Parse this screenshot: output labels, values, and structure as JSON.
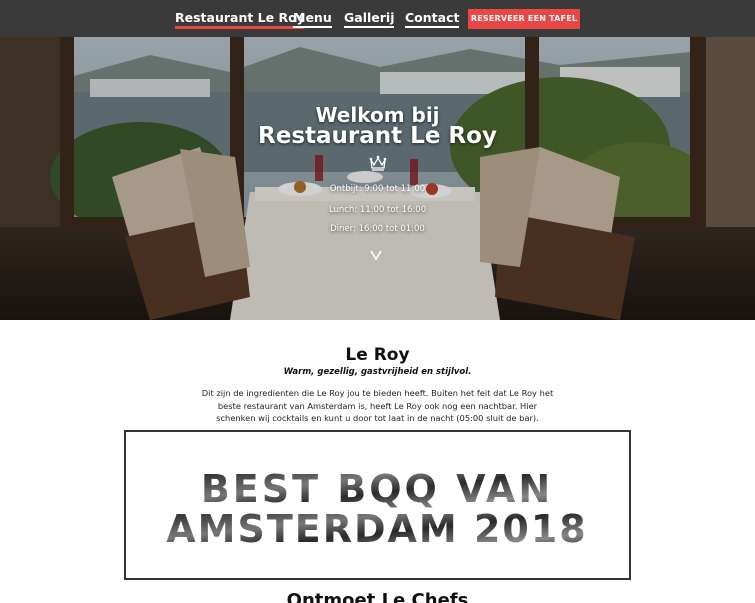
{
  "nav": {
    "brand": "Restaurant Le Roy",
    "menu": "Menu",
    "gallery": "Gallerij",
    "contact": "Contact",
    "reserve_button": "RESERVEER EEN TAFEL"
  },
  "hero": {
    "welcome_line1": "Welkom bij",
    "welcome_line2": "Restaurant Le Roy",
    "hours": [
      "Ontbijt: 9:00 tot 11:00",
      "Lunch: 11:00 tot 16:00",
      "Diner: 16:00 tot 01:00"
    ],
    "crown_icon": "crown-icon",
    "scroll_icon": "chevron-down-icon"
  },
  "about": {
    "title": "Le Roy",
    "subtitle": "Warm, gezellig, gastvrijheid en stijlvol.",
    "body": "Dit zijn de ingredienten die Le Roy jou te bieden heeft. Buiten het feit dat Le Roy het beste restaurant van Amsterdam is, heeft Le Roy ook nog een nachtbar. Hier schenken wij cocktails en kunt u door tot laat in de nacht (05:00 sluit de bar)."
  },
  "award": {
    "line1": "BEST BQQ VAN",
    "line2": "AMSTERDAM 2018"
  },
  "next_section": {
    "title": "Ontmoet Le Chefs"
  },
  "colors": {
    "nav_bg": "#3a3a3a",
    "accent": "#e94646"
  }
}
